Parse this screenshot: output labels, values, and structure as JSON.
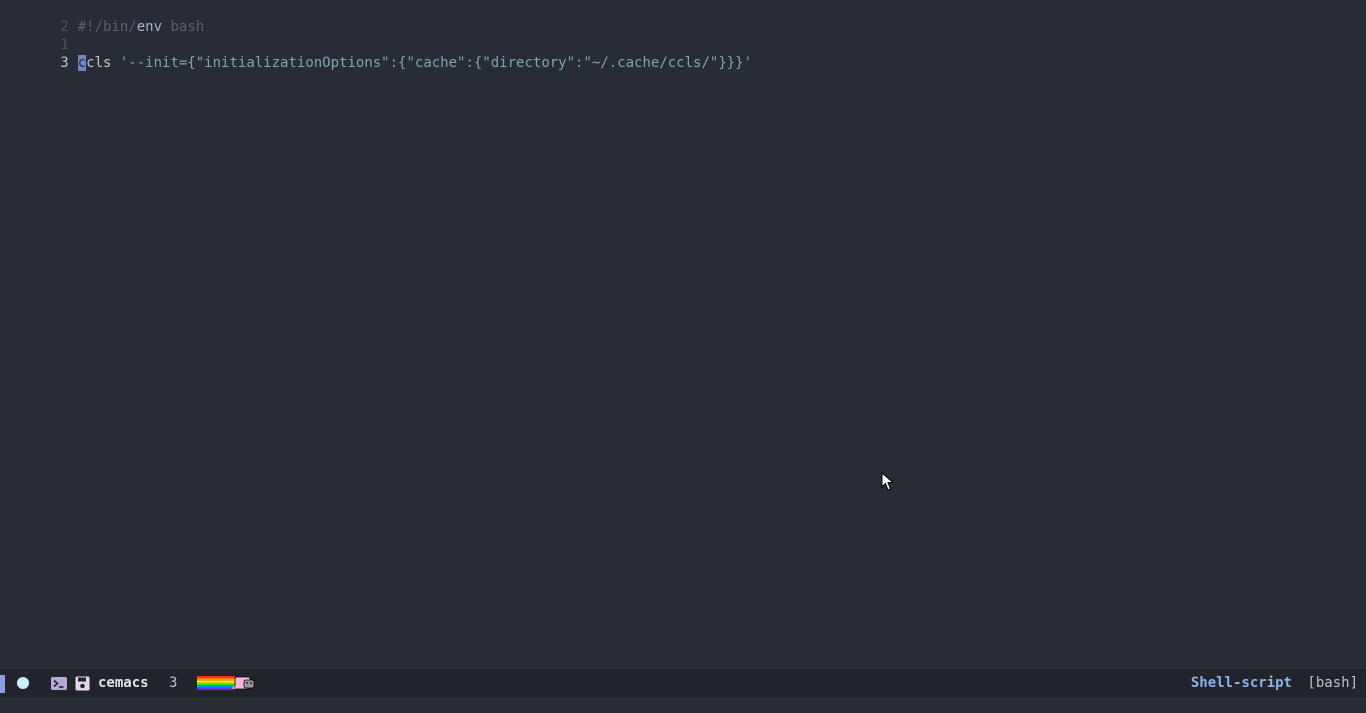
{
  "editor": {
    "lines": [
      {
        "number": "2",
        "text_comment_prefix": "#!/bin/",
        "text_comment_kw": "env",
        "text_comment_suffix": " bash"
      },
      {
        "number": "1",
        "text": ""
      },
      {
        "number": "3",
        "cursor_char": "c",
        "cmd_rest": "cls",
        "string": " '--init={\"initializationOptions\":{\"cache\":{\"directory\":\"~/.cache/ccls/\"}}}'"
      }
    ]
  },
  "modeline": {
    "buffer_name": "cemacs",
    "line_number": "3",
    "major_mode": "Shell-script",
    "env": "[bash]",
    "icons": [
      "status-dot-icon",
      "terminal-icon",
      "save-icon",
      "nyan-cat-icon"
    ]
  },
  "colors": {
    "background": "#282c34",
    "modeline_bg": "#21242b",
    "major_mode": "#8cb3e6",
    "string": "#7ca7ab",
    "cursor": "#6f88c8"
  }
}
